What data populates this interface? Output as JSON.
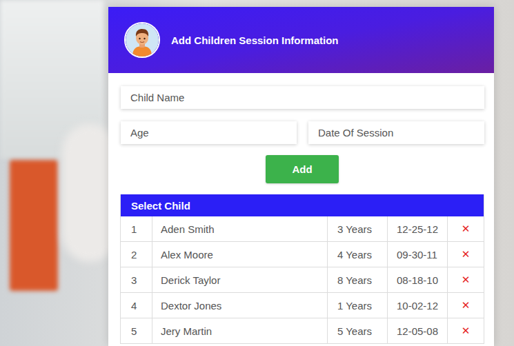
{
  "header": {
    "title": "Add Children Session Information"
  },
  "form": {
    "fields": [
      {
        "placeholder": "Child Name"
      },
      {
        "placeholder": "Age"
      },
      {
        "placeholder": "Date Of Session"
      }
    ],
    "button": "Add"
  },
  "table": {
    "title": "Select Child",
    "rows": [
      {
        "index": "1",
        "name": "Aden Smith",
        "age": "3 Years",
        "date": "12-25-12",
        "remove": "✕"
      },
      {
        "index": "2",
        "name": "Alex Moore",
        "age": "4 Years",
        "date": "09-30-11",
        "remove": "✕"
      },
      {
        "index": "3",
        "name": "Derick Taylor",
        "age": "8 Years",
        "date": "08-18-10",
        "remove": "✕"
      },
      {
        "index": "4",
        "name": "Dextor Jones",
        "age": "1 Years",
        "date": "10-02-12",
        "remove": "✕"
      },
      {
        "index": "5",
        "name": "Jery Martin",
        "age": "5 Years",
        "date": "12-05-08",
        "remove": "✕"
      }
    ]
  }
}
